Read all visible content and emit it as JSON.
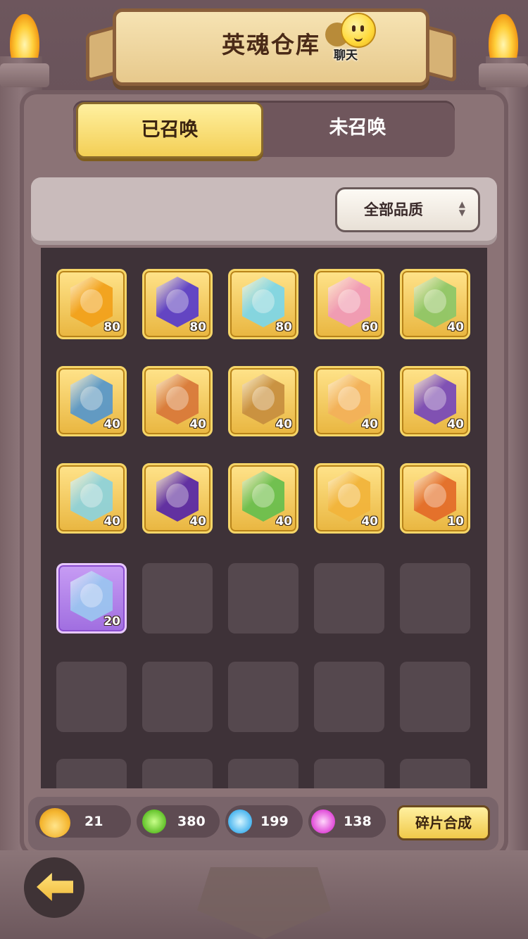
{
  "header": {
    "title": "英魂仓库",
    "chat_label": "聊天"
  },
  "tabs": [
    {
      "label": "已召唤",
      "active": true
    },
    {
      "label": "未召唤",
      "active": false
    }
  ],
  "filter": {
    "selected": "全部品质"
  },
  "inventory": [
    {
      "rarity": "gold",
      "count": "80",
      "color": "#f2a21c"
    },
    {
      "rarity": "gold",
      "count": "80",
      "color": "#5b3fc9"
    },
    {
      "rarity": "gold",
      "count": "80",
      "color": "#7fd6e6"
    },
    {
      "rarity": "gold",
      "count": "60",
      "color": "#f09ab8"
    },
    {
      "rarity": "gold",
      "count": "40",
      "color": "#8fc768"
    },
    {
      "rarity": "gold",
      "count": "40",
      "color": "#5a98c9"
    },
    {
      "rarity": "gold",
      "count": "40",
      "color": "#d87a3a"
    },
    {
      "rarity": "gold",
      "count": "40",
      "color": "#c89040"
    },
    {
      "rarity": "gold",
      "count": "40",
      "color": "#f3b25a"
    },
    {
      "rarity": "gold",
      "count": "40",
      "color": "#7a4bb8"
    },
    {
      "rarity": "gold",
      "count": "40",
      "color": "#8fd2da"
    },
    {
      "rarity": "gold",
      "count": "40",
      "color": "#5a2aa5"
    },
    {
      "rarity": "gold",
      "count": "40",
      "color": "#6abf4e"
    },
    {
      "rarity": "gold",
      "count": "40",
      "color": "#f2b53b"
    },
    {
      "rarity": "gold",
      "count": "10",
      "color": "#e36d2a"
    },
    {
      "rarity": "purple",
      "count": "20",
      "color": "#9bc4f0"
    }
  ],
  "resources": {
    "soul": {
      "value": "21",
      "icon": "flame-soul-icon",
      "color": "#f4c04a"
    },
    "green": {
      "value": "380",
      "icon": "green-essence-icon",
      "color": "#7ad13b"
    },
    "blue": {
      "value": "199",
      "icon": "blue-essence-icon",
      "color": "#57c0f2"
    },
    "pink": {
      "value": "138",
      "icon": "pink-essence-icon",
      "color": "#e65de0"
    }
  },
  "combine_button": "碎片合成"
}
